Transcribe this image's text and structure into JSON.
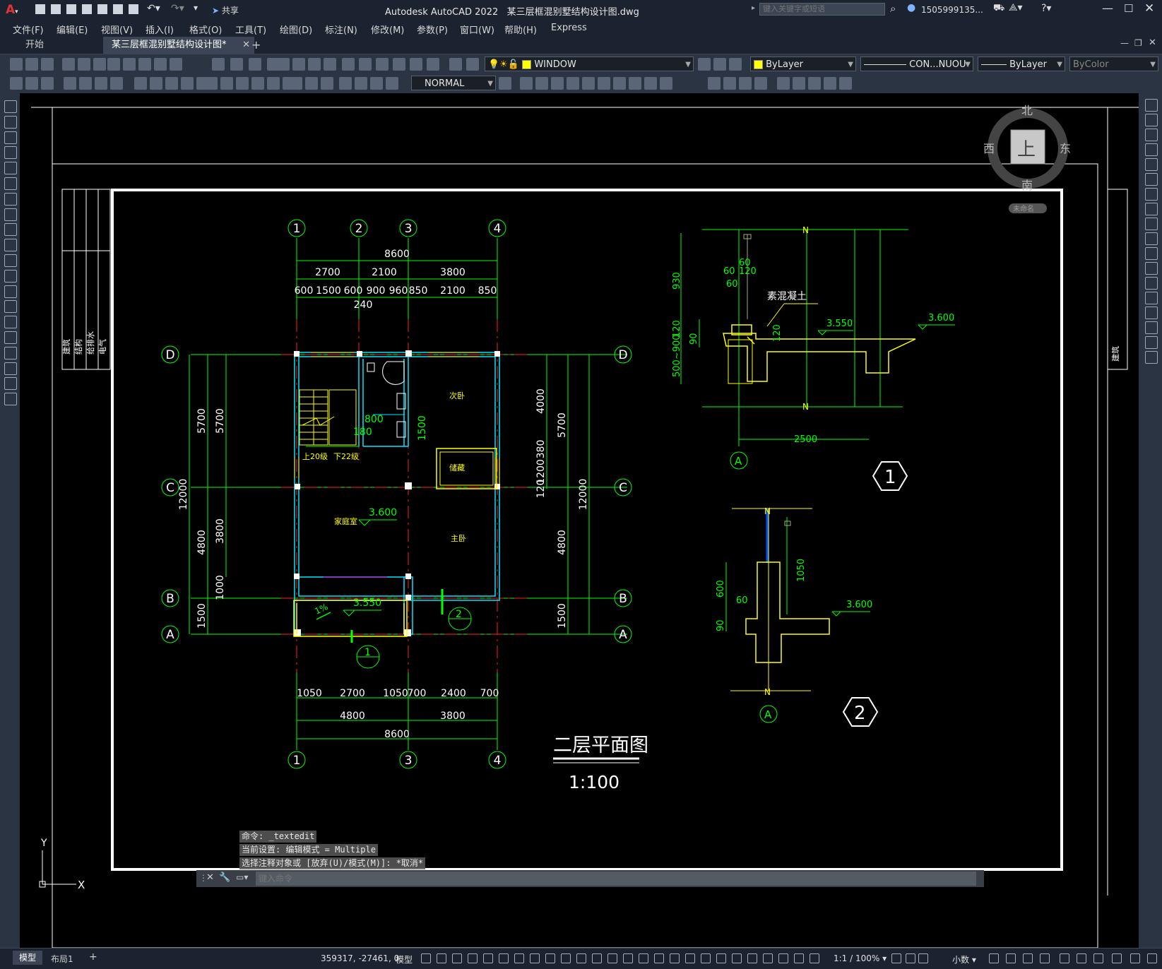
{
  "app": {
    "title": "Autodesk AutoCAD 2022",
    "file": "某三层框混别墅结构设计图.dwg",
    "search_placeholder": "键入关键字或短语",
    "user": "1505999135...",
    "share_label": "共享"
  },
  "menu": [
    "文件(F)",
    "编辑(E)",
    "视图(V)",
    "插入(I)",
    "格式(O)",
    "工具(T)",
    "绘图(D)",
    "标注(N)",
    "修改(M)",
    "参数(P)",
    "窗口(W)",
    "帮助(H)",
    "Express"
  ],
  "tabs": {
    "start": "开始",
    "active": "某三层框混别墅结构设计图*",
    "add": "+"
  },
  "toolbar": {
    "layer": "WINDOW",
    "color": "ByLayer",
    "linetype": "CON...NUOU",
    "lineweight": "ByLayer",
    "plotstyle": "ByColor",
    "dimstyle": "NORMAL"
  },
  "viewcube": {
    "north": "北",
    "south": "南",
    "east": "东",
    "west": "西",
    "face": "上",
    "wcs": "未命名"
  },
  "title_block": [
    "建筑",
    "结构",
    "给排水",
    "电气"
  ],
  "drawing": {
    "title": "二层平面图",
    "scale": "1:100",
    "axis_top": [
      "1",
      "2",
      "3",
      "4"
    ],
    "axis_bottom": [
      "1",
      "3",
      "4"
    ],
    "axis_rows": [
      "D",
      "C",
      "B",
      "A"
    ],
    "dims_top_total": "8600",
    "dims_top_mid": [
      "2700",
      "2100",
      "3800"
    ],
    "dims_top_fine": [
      "600",
      "1500",
      "600",
      "900",
      "960",
      "850",
      "2100",
      "850"
    ],
    "dim_240": "240",
    "dims_bottom_fine": [
      "1050",
      "2700",
      "1050",
      "700",
      "2400",
      "700"
    ],
    "dims_bottom_mid": [
      "4800",
      "3800"
    ],
    "dims_bottom_total": "8600",
    "dims_left_outer": "12000",
    "dims_left_mid": [
      "5700",
      "4800",
      "1500"
    ],
    "dims_left_inner": [
      "5700",
      "3800",
      "1000"
    ],
    "dims_right_inner": [
      "4000",
      "380",
      "1200",
      "120"
    ],
    "dims_right_mid": [
      "5700",
      "4800",
      "1500"
    ],
    "dims_right_outer": "12000",
    "room_labels": [
      "次卧",
      "储藏",
      "家庭室",
      "主卧"
    ],
    "stair_labels": [
      "上20级",
      "下22级"
    ],
    "dim_800": "800",
    "dim_180": "180",
    "dim_1500": "1500",
    "elev_room": "3.600",
    "elev_balcony": "3.550",
    "slope": "1%",
    "section_marks": [
      "1",
      "2"
    ]
  },
  "detail1": {
    "label": "素混凝土",
    "dims_v": [
      "930",
      "120",
      "90",
      "500~900"
    ],
    "dims_small": [
      "60",
      "60",
      "120",
      "60",
      "120"
    ],
    "elev1": "3.550",
    "elev2": "3.600",
    "width": "2500",
    "axis": "A",
    "mark": "1",
    "n": "N"
  },
  "detail2": {
    "dims_v": [
      "600",
      "60",
      "90",
      "1050"
    ],
    "elev": "3.600",
    "axis": "A",
    "mark": "2",
    "n": "N"
  },
  "command": {
    "line1": "命令: _textedit",
    "line2": "当前设置: 编辑模式 = Multiple",
    "line3": "选择注释对象或 [放弃(U)/模式(M)]: *取消*",
    "placeholder": "键入命令"
  },
  "status": {
    "coords": "359317, -27461, 0",
    "model_label": "模型",
    "scale": "1:1 / 100%",
    "units": "小数",
    "layout_tabs": [
      "模型",
      "布局1",
      "+"
    ]
  },
  "ucs": {
    "x": "X",
    "y": "Y"
  }
}
